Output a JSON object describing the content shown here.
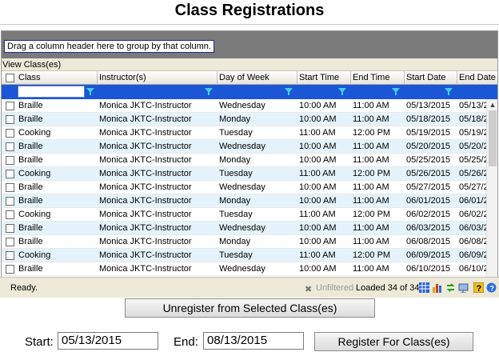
{
  "title": "Class Registrations",
  "grid": {
    "group_hint": "Drag a column header here to group by that column.",
    "caption": "View Class(es)",
    "columns": [
      "Class",
      "Instructor(s)",
      "Day of Week",
      "Start Time",
      "End Time",
      "Start Date",
      "End Date"
    ],
    "rows": [
      [
        "Braille",
        "Monica JKTC-Instructor",
        "Wednesday",
        "10:00 AM",
        "11:00 AM",
        "05/13/2015",
        "05/13/2"
      ],
      [
        "Braille",
        "Monica JKTC-Instructor",
        "Monday",
        "10:00 AM",
        "11:00 AM",
        "05/18/2015",
        "05/18/2"
      ],
      [
        "Cooking",
        "Monica JKTC-Instructor",
        "Tuesday",
        "11:00 AM",
        "12:00 PM",
        "05/19/2015",
        "05/19/2"
      ],
      [
        "Braille",
        "Monica JKTC-Instructor",
        "Wednesday",
        "10:00 AM",
        "11:00 AM",
        "05/20/2015",
        "05/20/2"
      ],
      [
        "Braille",
        "Monica JKTC-Instructor",
        "Monday",
        "10:00 AM",
        "11:00 AM",
        "05/25/2015",
        "05/25/2"
      ],
      [
        "Cooking",
        "Monica JKTC-Instructor",
        "Tuesday",
        "11:00 AM",
        "12:00 PM",
        "05/26/2015",
        "05/26/2"
      ],
      [
        "Braille",
        "Monica JKTC-Instructor",
        "Wednesday",
        "10:00 AM",
        "11:00 AM",
        "05/27/2015",
        "05/27/2"
      ],
      [
        "Braille",
        "Monica JKTC-Instructor",
        "Monday",
        "10:00 AM",
        "11:00 AM",
        "06/01/2015",
        "06/01/2"
      ],
      [
        "Cooking",
        "Monica JKTC-Instructor",
        "Tuesday",
        "11:00 AM",
        "12:00 PM",
        "06/02/2015",
        "06/02/2"
      ],
      [
        "Braille",
        "Monica JKTC-Instructor",
        "Wednesday",
        "10:00 AM",
        "11:00 AM",
        "06/03/2015",
        "06/03/2"
      ],
      [
        "Braille",
        "Monica JKTC-Instructor",
        "Monday",
        "10:00 AM",
        "11:00 AM",
        "06/08/2015",
        "06/08/2"
      ],
      [
        "Cooking",
        "Monica JKTC-Instructor",
        "Tuesday",
        "11:00 AM",
        "12:00 PM",
        "06/09/2015",
        "06/09/2"
      ],
      [
        "Braille",
        "Monica JKTC-Instructor",
        "Wednesday",
        "10:00 AM",
        "11:00 AM",
        "06/10/2015",
        "06/10/2"
      ]
    ]
  },
  "status": {
    "ready": "Ready.",
    "unfiltered": "Unfiltered",
    "loaded": "Loaded 34 of 34",
    "icons": [
      "filter-clear-icon",
      "grid-view-icon",
      "chart-icon",
      "refresh-icon",
      "export-icon",
      "help-icon",
      "info-icon"
    ]
  },
  "buttons": {
    "unregister": "Unregister from Selected Class(es)",
    "register": "Register For Class(es)"
  },
  "dates": {
    "start_label": "Start:",
    "start_value": "05/13/2015",
    "end_label": "End:",
    "end_value": "08/13/2015"
  },
  "colors": {
    "filter_row": "#1a56d6",
    "alt_row": "#e4f3fb",
    "group_panel": "#7a7a7a"
  }
}
